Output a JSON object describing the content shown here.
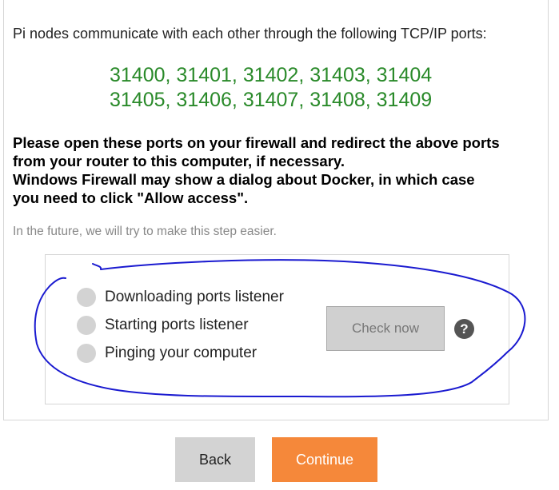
{
  "intro": "Pi nodes communicate with each other through the following TCP/IP ports:",
  "ports": {
    "line1": "31400, 31401, 31402, 31403, 31404",
    "line2": "31405, 31406, 31407, 31408, 31409"
  },
  "warning": {
    "line1": "Please open these ports on your firewall and redirect the above ports",
    "line2": "from your router to this computer, if necessary.",
    "line3": "Windows Firewall may show a dialog about Docker, in which case",
    "line4": "you need to click \"Allow access\"."
  },
  "future_note": "In the future, we will try to make this step easier.",
  "steps": [
    {
      "label": "Downloading ports listener",
      "icon": "status-dot-icon"
    },
    {
      "label": "Starting ports listener",
      "icon": "status-dot-icon"
    },
    {
      "label": "Pinging your computer",
      "icon": "status-dot-icon"
    }
  ],
  "check_button": "Check now",
  "help_icon": "?",
  "footer": {
    "back": "Back",
    "continue": "Continue"
  },
  "colors": {
    "ports_text": "#2a8a2a",
    "continue_button": "#f5883a",
    "annotation_ink": "#1a1ad0"
  }
}
